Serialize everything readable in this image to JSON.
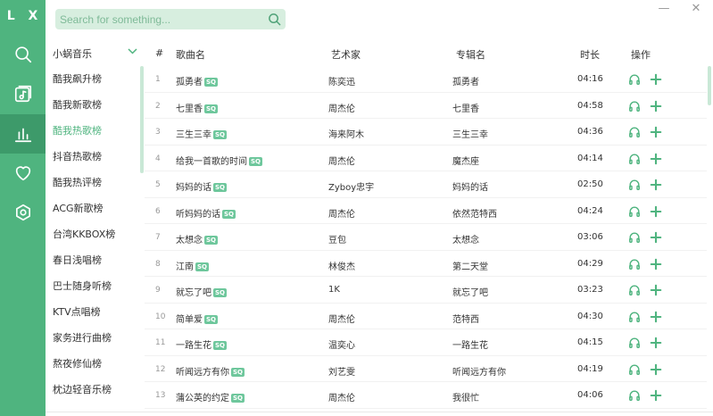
{
  "app": {
    "logo": "L X"
  },
  "search": {
    "placeholder": "Search for something..."
  },
  "window": {
    "minimize": "—",
    "close": "✕"
  },
  "nav": [
    {
      "name": "search",
      "icon": "search-icon",
      "active": false
    },
    {
      "name": "songlist",
      "icon": "music-list-icon",
      "active": false
    },
    {
      "name": "leaderboard",
      "icon": "bar-chart-icon",
      "active": true
    },
    {
      "name": "favorites",
      "icon": "heart-icon",
      "active": false
    },
    {
      "name": "settings",
      "icon": "settings-icon",
      "active": false
    }
  ],
  "source": {
    "label": "小蜗音乐"
  },
  "boards": [
    {
      "label": "酷我飙升榜",
      "active": false
    },
    {
      "label": "酷我新歌榜",
      "active": false
    },
    {
      "label": "酷我热歌榜",
      "active": true
    },
    {
      "label": "抖音热歌榜",
      "active": false
    },
    {
      "label": "酷我热评榜",
      "active": false
    },
    {
      "label": "ACG新歌榜",
      "active": false
    },
    {
      "label": "台湾KKBOX榜",
      "active": false
    },
    {
      "label": "春日浅唱榜",
      "active": false
    },
    {
      "label": "巴士随身听榜",
      "active": false
    },
    {
      "label": "KTV点唱榜",
      "active": false
    },
    {
      "label": "家务进行曲榜",
      "active": false
    },
    {
      "label": "熬夜修仙榜",
      "active": false
    },
    {
      "label": "枕边轻音乐榜",
      "active": false
    }
  ],
  "table": {
    "headers": {
      "index": "#",
      "song": "歌曲名",
      "artist": "艺术家",
      "album": "专辑名",
      "duration": "时长",
      "actions": "操作"
    },
    "quality_badge": "SQ",
    "rows": [
      {
        "index": "1",
        "song": "孤勇者",
        "artist": "陈奕迅",
        "album": "孤勇者",
        "duration": "04:16"
      },
      {
        "index": "2",
        "song": "七里香",
        "artist": "周杰伦",
        "album": "七里香",
        "duration": "04:58"
      },
      {
        "index": "3",
        "song": "三生三幸",
        "artist": "海来阿木",
        "album": "三生三幸",
        "duration": "04:36"
      },
      {
        "index": "4",
        "song": "给我一首歌的时间",
        "artist": "周杰伦",
        "album": "魔杰座",
        "duration": "04:14"
      },
      {
        "index": "5",
        "song": "妈妈的话",
        "artist": "Zyboy忠宇",
        "album": "妈妈的话",
        "duration": "02:50"
      },
      {
        "index": "6",
        "song": "听妈妈的话",
        "artist": "周杰伦",
        "album": "依然范特西",
        "duration": "04:24"
      },
      {
        "index": "7",
        "song": "太想念",
        "artist": "豆包",
        "album": "太想念",
        "duration": "03:06"
      },
      {
        "index": "8",
        "song": "江南",
        "artist": "林俊杰",
        "album": "第二天堂",
        "duration": "04:29"
      },
      {
        "index": "9",
        "song": "就忘了吧",
        "artist": "1K",
        "album": "就忘了吧",
        "duration": "03:23"
      },
      {
        "index": "10",
        "song": "简单爱",
        "artist": "周杰伦",
        "album": "范特西",
        "duration": "04:30"
      },
      {
        "index": "11",
        "song": "一路生花",
        "artist": "温奕心",
        "album": "一路生花",
        "duration": "04:15"
      },
      {
        "index": "12",
        "song": "听闻远方有你",
        "artist": "刘艺雯",
        "album": "听闻远方有你",
        "duration": "04:19"
      },
      {
        "index": "13",
        "song": "蒲公英的约定",
        "artist": "周杰伦",
        "album": "我很忙",
        "duration": "04:06"
      }
    ]
  },
  "colors": {
    "accent": "#4fb47f",
    "accent_dark": "#3d9a6a",
    "search_bg": "#d7eedf",
    "badge": "#6ec79c"
  }
}
